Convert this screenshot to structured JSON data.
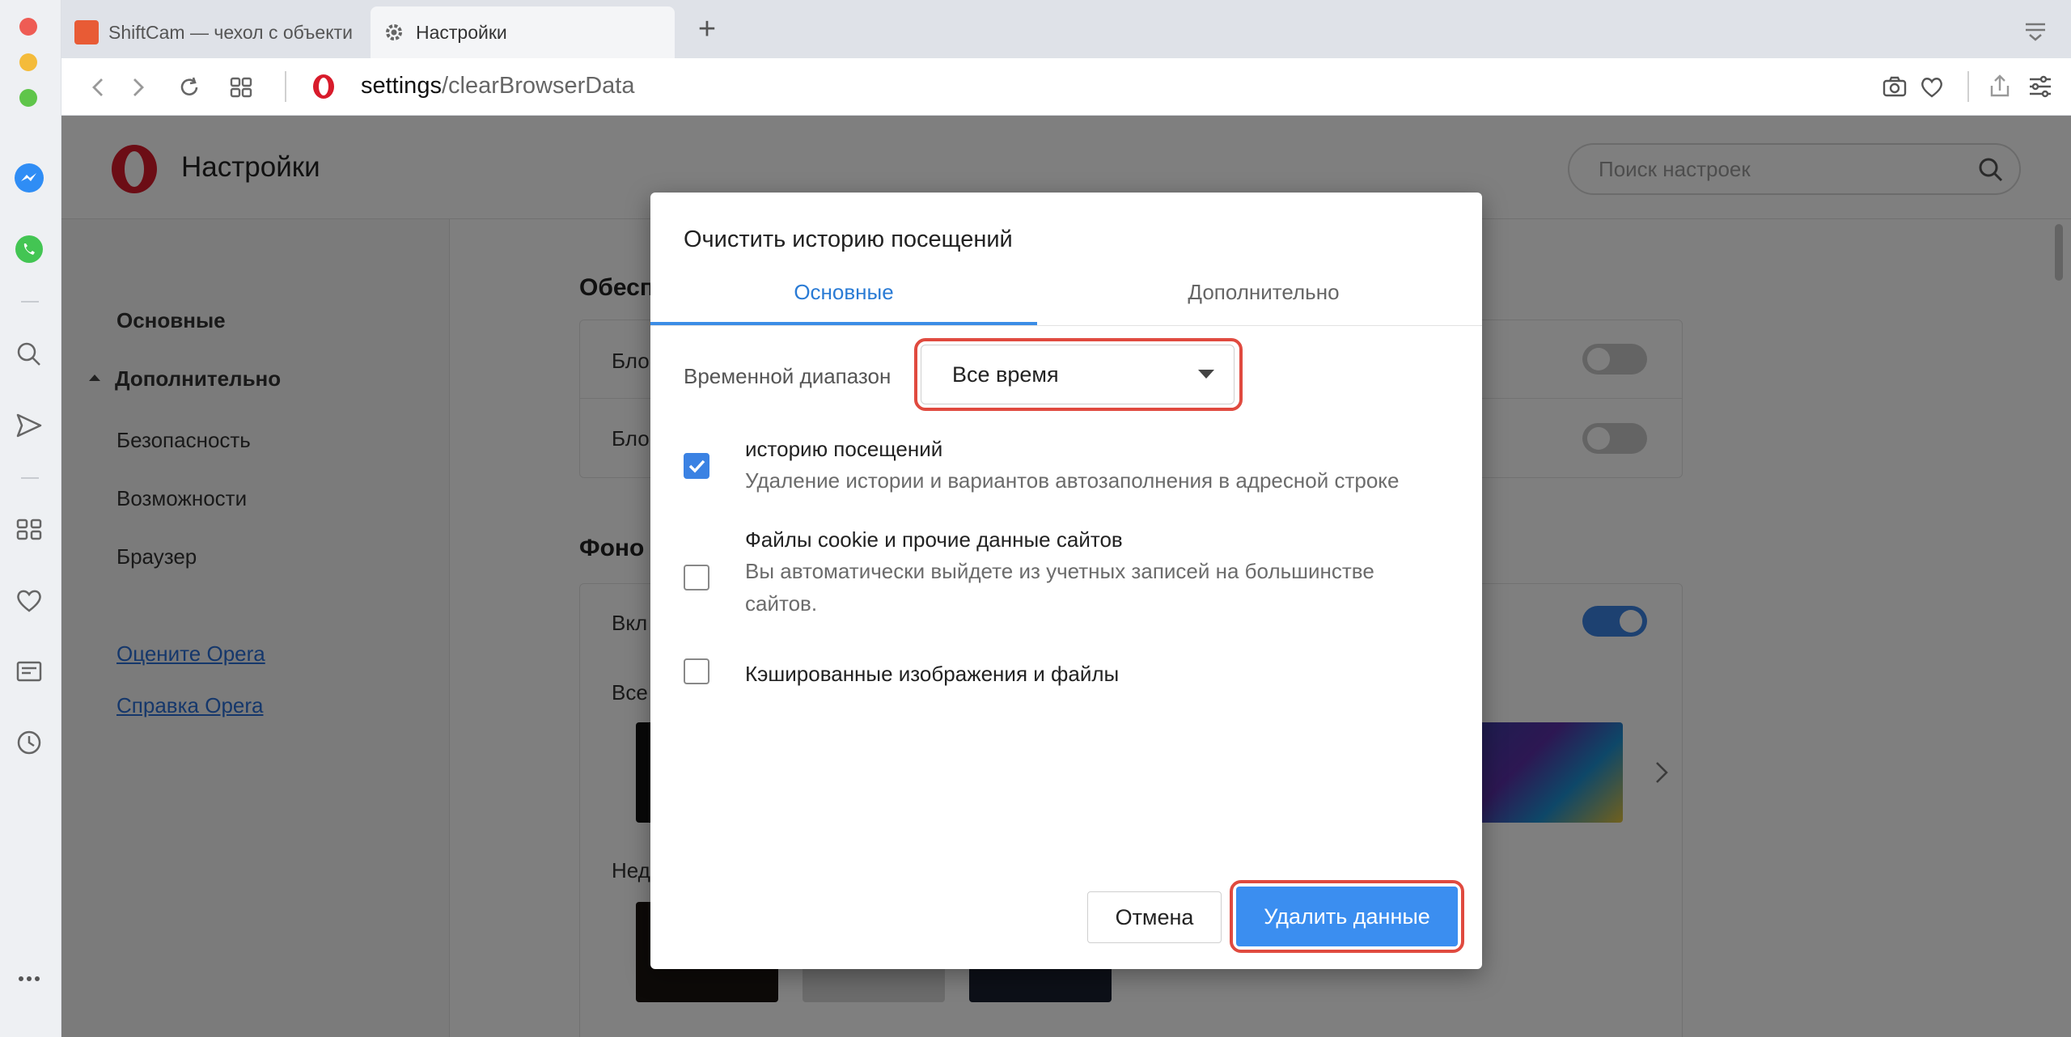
{
  "browser": {
    "tabs": [
      {
        "title": "ShiftCam — чехол с объекти",
        "favicon": "lifehacker-favicon"
      },
      {
        "title": "Настройки",
        "favicon": "gear-icon"
      }
    ],
    "new_tab_glyph": "+",
    "url_host": "settings",
    "url_path": "/clearBrowserData"
  },
  "settings_page": {
    "title": "Настройки",
    "search_placeholder": "Поиск настроек",
    "nav": {
      "basic": "Основные",
      "advanced": "Дополнительно",
      "security": "Безопасность",
      "features": "Возможности",
      "browser": "Браузер",
      "rate_link": "Оцените Opera",
      "help_link": "Справка Opera"
    },
    "background_fragments": {
      "section1": "Обесп",
      "row1": "Бло",
      "row2": "Бло",
      "section2": "Фоно",
      "row3": "Вкл",
      "row4": "Все",
      "row5": "Нед"
    }
  },
  "dialog": {
    "title": "Очистить историю посещений",
    "tabs": {
      "basic": "Основные",
      "advanced": "Дополнительно"
    },
    "time_range_label": "Временной диапазон",
    "time_range_value": "Все время",
    "options": [
      {
        "title": "историю посещений",
        "description": "Удаление истории и вариантов автозаполнения в адресной строке",
        "checked": true
      },
      {
        "title": "Файлы cookie и прочие данные сайтов",
        "description": "Вы автоматически выйдете из учетных записей на большинстве сайтов.",
        "checked": false
      },
      {
        "title": "Кэшированные изображения и файлы",
        "description": "",
        "checked": false
      }
    ],
    "cancel_label": "Отмена",
    "delete_label": "Удалить данные"
  },
  "colors": {
    "accent": "#3b8ef0",
    "highlight_ring": "#e04a3f",
    "opera_red": "#d81b2b"
  }
}
